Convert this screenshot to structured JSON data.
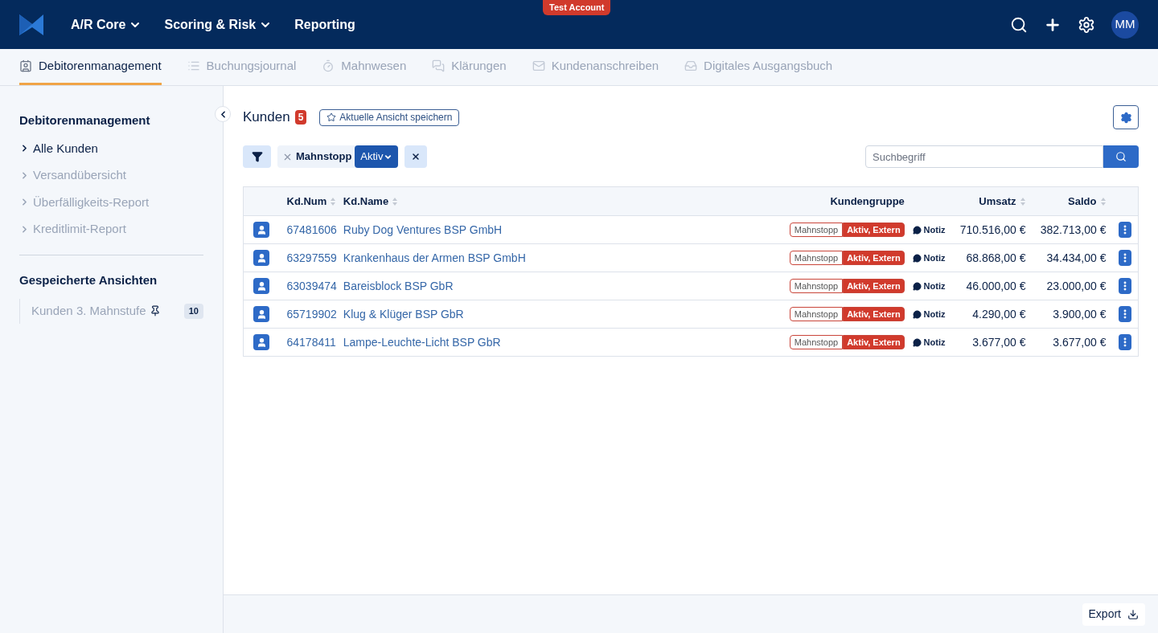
{
  "topbar": {
    "badge": "Test Account",
    "menus": [
      {
        "label": "A/R Core",
        "dropdown": true
      },
      {
        "label": "Scoring & Risk",
        "dropdown": true
      },
      {
        "label": "Reporting",
        "dropdown": false
      }
    ],
    "avatar": "MM"
  },
  "tabs": [
    {
      "label": "Debitorenmanagement",
      "selected": true
    },
    {
      "label": "Buchungsjournal",
      "selected": false
    },
    {
      "label": "Mahnwesen",
      "selected": false
    },
    {
      "label": "Klärungen",
      "selected": false
    },
    {
      "label": "Kundenanschreiben",
      "selected": false
    },
    {
      "label": "Digitales Ausgangsbuch",
      "selected": false
    }
  ],
  "sidebar": {
    "title": "Debitorenmanagement",
    "items": [
      {
        "label": "Alle Kunden",
        "selected": true
      },
      {
        "label": "Versandübersicht",
        "selected": false
      },
      {
        "label": "Überfälligkeits-Report",
        "selected": false
      },
      {
        "label": "Kreditlimit-Report",
        "selected": false
      }
    ],
    "saved_title": "Gespeicherte Ansichten",
    "saved": [
      {
        "label": "Kunden 3. Mahnstufe",
        "pinned": true,
        "count": "10"
      }
    ]
  },
  "main": {
    "title": "Kunden",
    "count": "5",
    "save_view": "Aktuelle Ansicht speichern",
    "filter": {
      "label": "Mahnstopp",
      "value": "Aktiv"
    },
    "search": {
      "placeholder": "Suchbegriff"
    },
    "table": {
      "columns": [
        {
          "label": "Kd.Num",
          "sortable": true
        },
        {
          "label": "Kd.Name",
          "sortable": true
        },
        {
          "label": "Kundengruppe",
          "sortable": false
        },
        {
          "label": "Umsatz",
          "sortable": true
        },
        {
          "label": "Saldo",
          "sortable": true
        }
      ],
      "rows": [
        {
          "num": "67481606",
          "name": "Ruby Dog Ventures BSP GmbH",
          "tag_label": "Mahnstopp",
          "tag_value": "Aktiv, Extern",
          "note": "Notiz",
          "umsatz": "710.516,00 €",
          "saldo": "382.713,00 €"
        },
        {
          "num": "63297559",
          "name": "Krankenhaus der Armen BSP GmbH",
          "tag_label": "Mahnstopp",
          "tag_value": "Aktiv, Extern",
          "note": "Notiz",
          "umsatz": "68.868,00 €",
          "saldo": "34.434,00 €"
        },
        {
          "num": "63039474",
          "name": "Bareisblock BSP GbR",
          "tag_label": "Mahnstopp",
          "tag_value": "Aktiv, Extern",
          "note": "Notiz",
          "umsatz": "46.000,00 €",
          "saldo": "23.000,00 €"
        },
        {
          "num": "65719902",
          "name": "Klug & Klüger BSP GbR",
          "tag_label": "Mahnstopp",
          "tag_value": "Aktiv, Extern",
          "note": "Notiz",
          "umsatz": "4.290,00 €",
          "saldo": "3.900,00 €"
        },
        {
          "num": "64178411",
          "name": "Lampe-Leuchte-Licht BSP GbR",
          "tag_label": "Mahnstopp",
          "tag_value": "Aktiv, Extern",
          "note": "Notiz",
          "umsatz": "3.677,00 €",
          "saldo": "3.677,00 €"
        }
      ]
    },
    "export": "Export"
  }
}
